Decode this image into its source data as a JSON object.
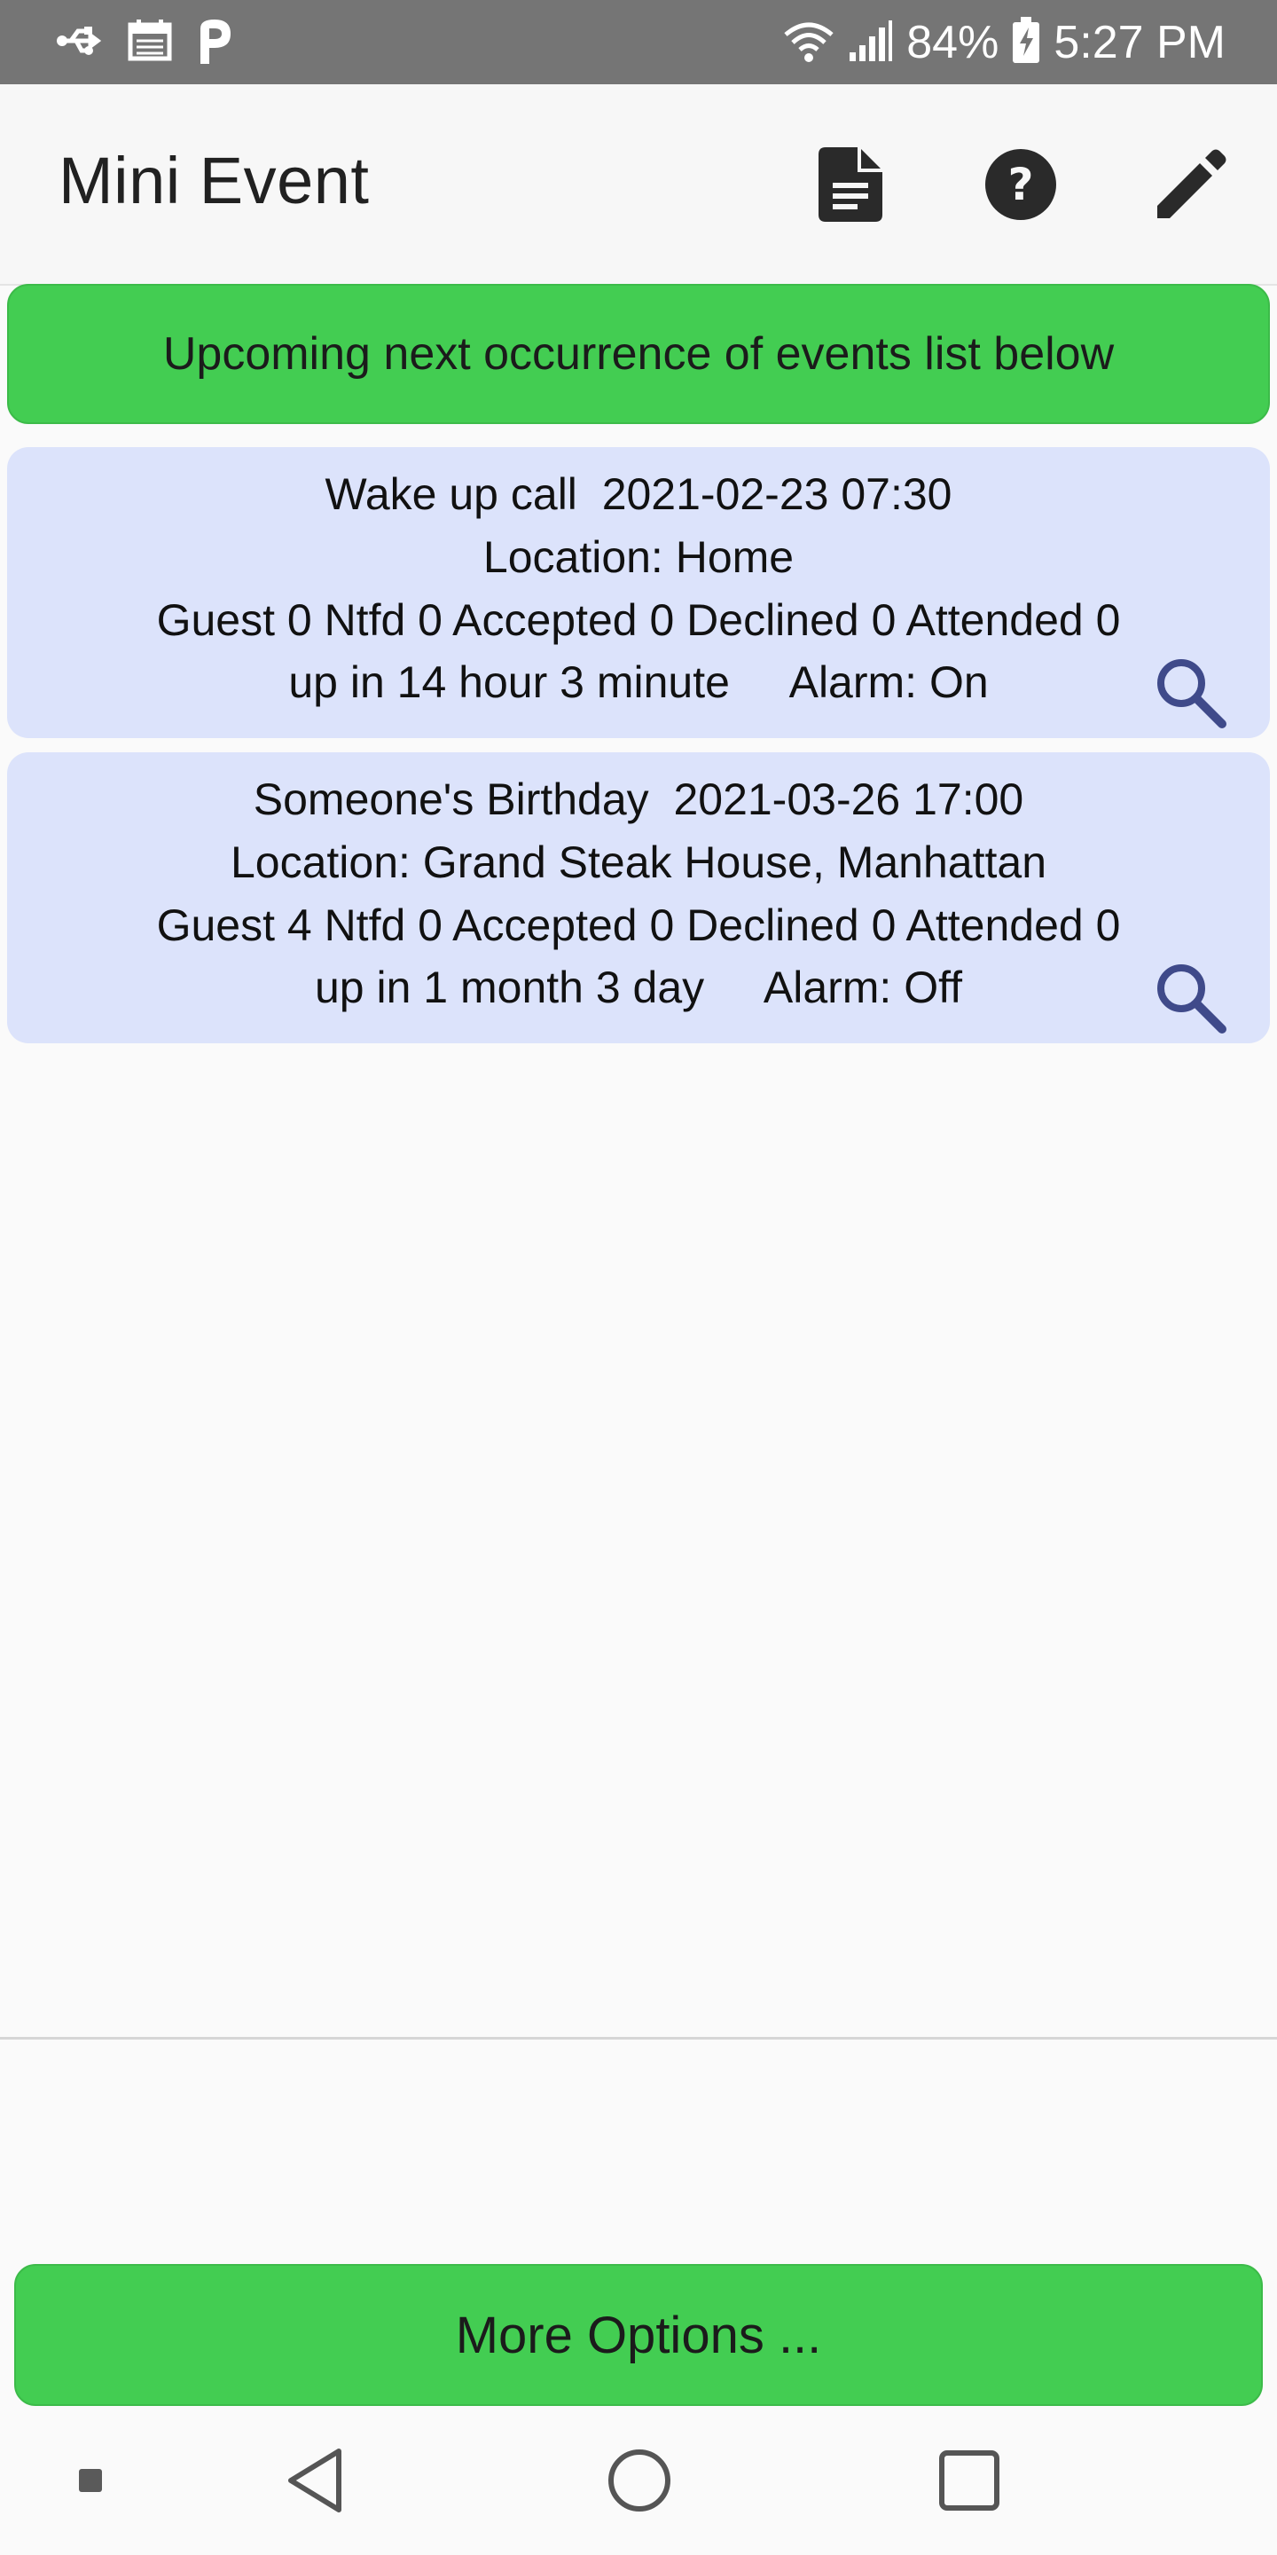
{
  "status_bar": {
    "battery": "84%",
    "time": "5:27 PM",
    "icons": [
      "usb-icon",
      "calendar-icon",
      "parking-icon",
      "wifi-icon",
      "signal-icon",
      "battery-charging-icon"
    ]
  },
  "app_bar": {
    "title": "Mini Event",
    "actions": [
      "document-icon",
      "help-icon",
      "edit-icon"
    ]
  },
  "banner": {
    "text": "Upcoming next occurrence of events list below"
  },
  "events": [
    {
      "title_line": "Wake up call  2021-02-23 07:30",
      "location_line": "Location: Home",
      "counts_line": "Guest 0 Ntfd 0 Accepted 0 Declined 0 Attended 0",
      "status_line": "up in 14 hour 3 minute     Alarm: On"
    },
    {
      "title_line": "Someone's Birthday  2021-03-26 17:00",
      "location_line": "Location: Grand Steak House, Manhattan",
      "counts_line": "Guest 4 Ntfd 0 Accepted 0 Declined 0 Attended 0",
      "status_line": "up in 1 month 3 day     Alarm: Off"
    }
  ],
  "more_options": {
    "label": "More Options ..."
  },
  "nav_bar": {
    "items": [
      "recent-dot-icon",
      "back-icon",
      "home-icon",
      "overview-icon"
    ]
  },
  "colors": {
    "status_bar": "#757575",
    "accent_green": "#43cd52",
    "card_bg": "#dce3fb",
    "search_icon": "#3f4a8a"
  }
}
